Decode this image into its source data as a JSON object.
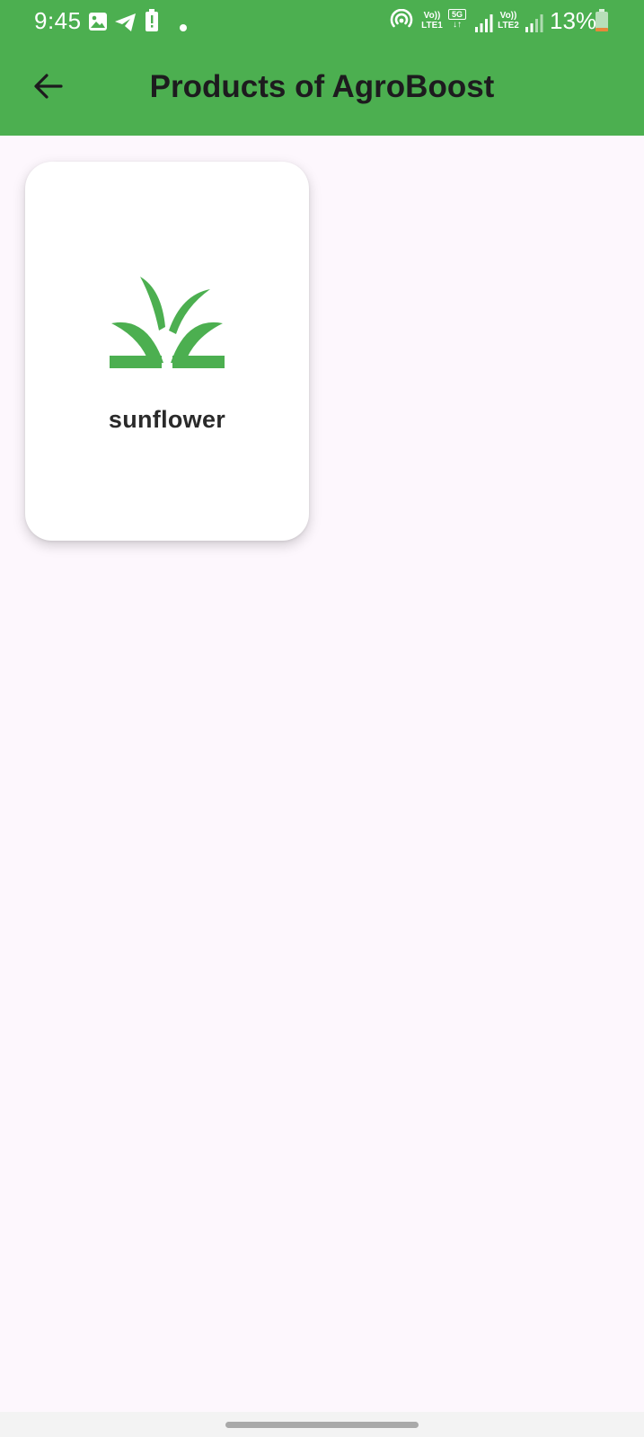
{
  "status_bar": {
    "time": "9:45",
    "battery_percent": "13%",
    "sim1_label_top": "Vo))",
    "sim1_label_bottom": "LTE1",
    "network_type": "5G",
    "sim2_label_top": "Vo))",
    "sim2_label_bottom": "LTE2",
    "icons": [
      "gallery-icon",
      "telegram-icon",
      "battery-alert-icon",
      "dot-icon",
      "hotspot-icon",
      "signal-icon",
      "battery-icon"
    ]
  },
  "app_bar": {
    "title": "Products of AgroBoost",
    "back_icon": "arrow-back-icon"
  },
  "products": [
    {
      "name": "sunflower",
      "icon": "grass-icon",
      "icon_color": "#4caf50"
    }
  ],
  "colors": {
    "primary": "#4caf50",
    "background": "#fdf7fd",
    "card": "#ffffff",
    "text": "#1d1b1e"
  }
}
